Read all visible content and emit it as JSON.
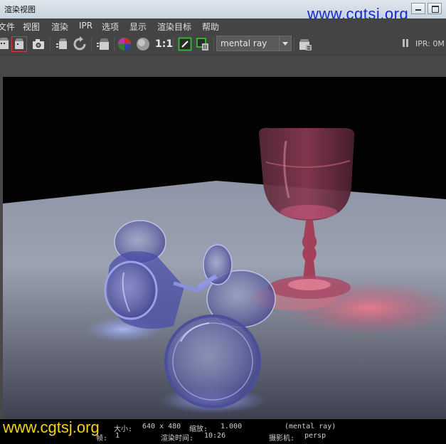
{
  "window": {
    "title": "渲染视图",
    "watermark": "www.cgtsj.org"
  },
  "menu": [
    "文件",
    "视图",
    "渲染",
    "IPR",
    "选项",
    "显示",
    "渲染目标",
    "帮助"
  ],
  "toolbar": {
    "ratio_label": "1:1",
    "renderer": "mental ray",
    "ipr_status": "IPR: 0M"
  },
  "render_info": {
    "size_label": "大小:",
    "size_value": "640 x 480",
    "zoom_label": "缩放:",
    "zoom_value": "1.000",
    "renderer": "(mental ray)",
    "frame_label": "帧:",
    "frame_value": "1",
    "time_label": "渲染时间:",
    "time_value": "10:26",
    "camera_label": "摄影机:",
    "camera_value": "persp"
  },
  "colors": {
    "watermark_top": "#1428d8",
    "watermark_bottom": "#f2d21a",
    "panel": "#444444",
    "glass_blue": "#6f6fd8",
    "glass_red": "#c0405a"
  }
}
